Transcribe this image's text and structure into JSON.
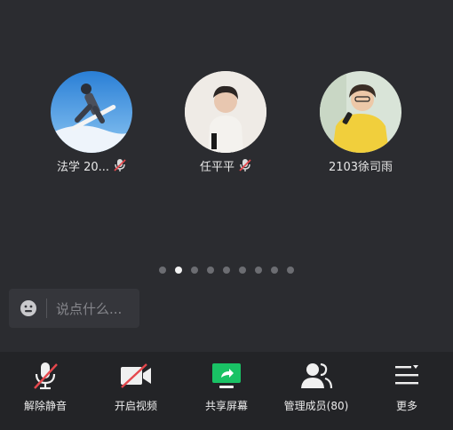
{
  "participants": [
    {
      "name": "法学 20...",
      "muted": true,
      "avatar": "snowboard-avatar"
    },
    {
      "name": "任平平",
      "muted": true,
      "avatar": "person-avatar"
    },
    {
      "name": "2103徐司雨",
      "muted": false,
      "avatar": "yellow-hoodie-avatar"
    }
  ],
  "pager": {
    "total": 9,
    "active_index": 1
  },
  "chat": {
    "placeholder": "说点什么..."
  },
  "toolbar": {
    "unmute_label": "解除静音",
    "video_label": "开启视频",
    "share_label": "共享屏幕",
    "members_label": "管理成员(80)",
    "more_label": "更多"
  },
  "colors": {
    "background": "#2b2c30",
    "toolbar": "#232427",
    "muted_red": "#e5484d",
    "share_green": "#19c265"
  }
}
